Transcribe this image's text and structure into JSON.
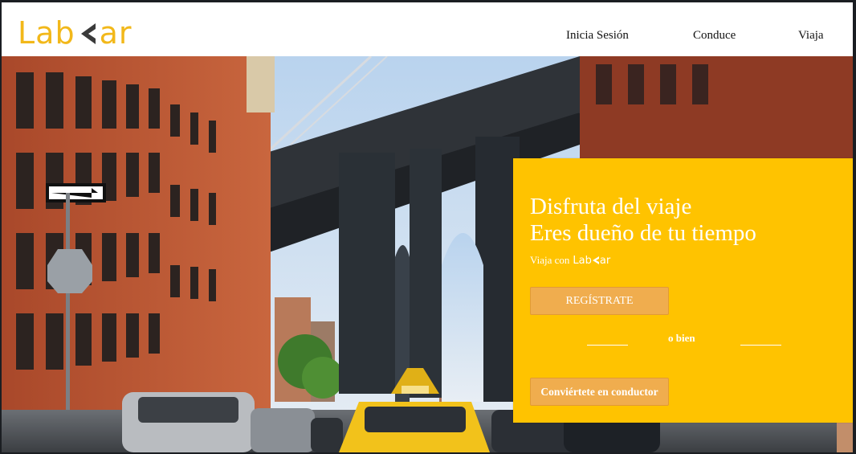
{
  "brand": {
    "logo_left": "Lab",
    "logo_right": "ar",
    "color": "#f2b81a",
    "arrow_color": "#3a3a3a"
  },
  "nav": {
    "items": [
      {
        "label": "Inicia Sesión"
      },
      {
        "label": "Conduce"
      },
      {
        "label": "Viaja"
      }
    ]
  },
  "hero": {
    "image_alt": "Calle de Brooklyn con el puente de Manhattan y un taxi amarillo",
    "panel": {
      "color": "#ffc300",
      "title_line1": "Disfruta del viaje",
      "title_line2": "Eres dueño de tu tiempo",
      "viaja_con": "Viaja con",
      "mini_logo_left": "Lab",
      "mini_logo_right": "ar",
      "register_label": "REGÍSTRATE",
      "or_text": "o bien",
      "driver_label": "Conviértete en conductor",
      "button_color": "#f0ad4e"
    }
  }
}
